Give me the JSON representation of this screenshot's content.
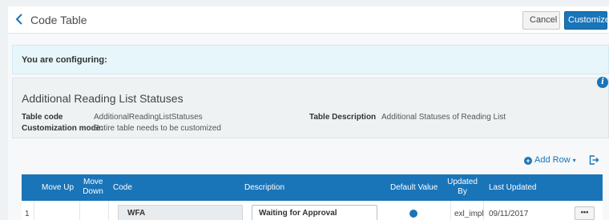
{
  "header": {
    "title": "Code Table",
    "cancel_label": "Cancel",
    "customize_label": "Customize"
  },
  "configuring": {
    "text": "You are configuring:"
  },
  "info": {
    "title": "Additional Reading List Statuses",
    "table_code_label": "Table code",
    "table_code_value": "AdditionalReadingListStatuses",
    "customization_mode_label": "Customization mode:",
    "customization_mode_value": "Entire table needs to be customized",
    "table_description_label": "Table Description",
    "table_description_value": "Additional Statuses of Reading List",
    "info_icon": "i"
  },
  "toolbar": {
    "add_row_label": "Add Row",
    "add_icon": "+",
    "caret": "▾"
  },
  "table": {
    "columns": {
      "move_up": "Move Up",
      "move_down_1": "Move",
      "move_down_2": "Down",
      "code": "Code",
      "description": "Description",
      "default_value": "Default Value",
      "updated_by_1": "Updated",
      "updated_by_2": "By",
      "last_updated": "Last Updated"
    },
    "rows": [
      {
        "index": "1",
        "code": "WFA",
        "description": "Waiting for Approval",
        "updated_by": "exl_impl",
        "last_updated": "09/11/2017",
        "more": "•••"
      }
    ]
  },
  "colors": {
    "accent": "#1a74b8",
    "configuring_bg": "#e6f6fa"
  }
}
